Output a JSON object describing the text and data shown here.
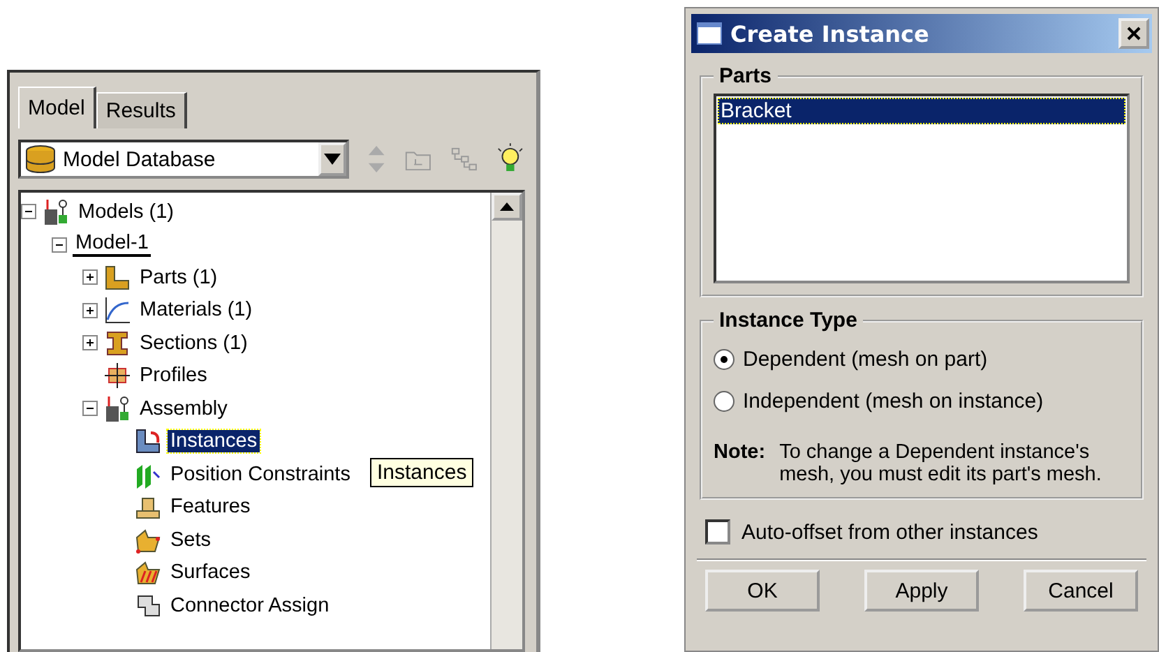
{
  "model_tree": {
    "tabs": [
      {
        "label": "Model",
        "selected": true
      },
      {
        "label": "Results",
        "selected": false
      }
    ],
    "database_combo": {
      "value": "Model Database"
    },
    "tree": [
      {
        "label": "Models (1)",
        "kind": "models",
        "expanded": true,
        "selected": false,
        "children": [
          {
            "label": "Model-1",
            "expanded": true,
            "active": true,
            "selected": false,
            "children": [
              {
                "label": "Parts (1)",
                "kind": "parts",
                "expanded": false,
                "selected": false
              },
              {
                "label": "Materials (1)",
                "kind": "materials",
                "expanded": false,
                "selected": false
              },
              {
                "label": "Sections (1)",
                "kind": "sections",
                "expanded": false,
                "selected": false
              },
              {
                "label": "Profiles",
                "kind": "profiles",
                "selected": false
              },
              {
                "label": "Assembly",
                "kind": "models",
                "expanded": true,
                "selected": false,
                "children": [
                  {
                    "label": "Instances",
                    "kind": "instances",
                    "selected": true
                  },
                  {
                    "label": "Position Constraints",
                    "kind": "constraints",
                    "selected": false
                  },
                  {
                    "label": "Features",
                    "kind": "features",
                    "selected": false
                  },
                  {
                    "label": "Sets",
                    "kind": "sets",
                    "selected": false
                  },
                  {
                    "label": "Surfaces",
                    "kind": "surfaces",
                    "selected": false
                  },
                  {
                    "label": "Connector Assign",
                    "kind": "connector",
                    "selected": false
                  }
                ]
              }
            ]
          }
        ]
      }
    ],
    "tooltip": "Instances"
  },
  "dialog": {
    "title": "Create Instance",
    "parts": {
      "label": "Parts",
      "items": [
        {
          "label": "Bracket",
          "selected": true
        }
      ]
    },
    "instance_type": {
      "label": "Instance Type",
      "options": [
        {
          "label": "Dependent (mesh on part)",
          "selected": true
        },
        {
          "label": "Independent (mesh on instance)",
          "selected": false
        }
      ],
      "note_label": "Note:",
      "note": "To change a Dependent instance's mesh, you must edit its part's mesh."
    },
    "auto_offset": {
      "label": "Auto-offset from other instances",
      "checked": false
    },
    "buttons": [
      "OK",
      "Apply",
      "Cancel"
    ]
  }
}
